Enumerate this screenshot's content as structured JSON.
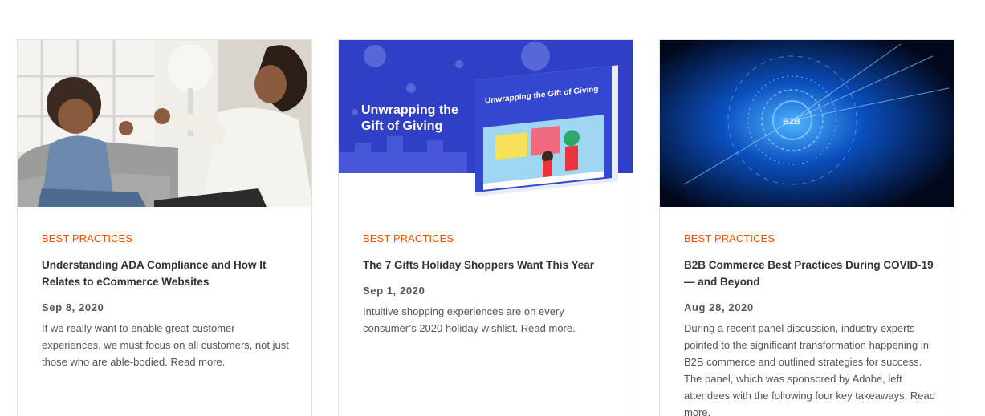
{
  "cards": [
    {
      "category": "BEST PRACTICES",
      "title": "Understanding ADA Compliance and How It Relates to eCommerce Websites",
      "date": "Sep 8, 2020",
      "excerpt": "If we really want to enable great customer experiences, we must focus on all customers, not just those who are able-bodied.",
      "read_more": "Read more.",
      "image": "woman-and-girl-photo"
    },
    {
      "category": "BEST PRACTICES",
      "title": "The 7 Gifts Holiday Shoppers Want This Year",
      "date": "Sep 1, 2020",
      "excerpt": "Intuitive shopping experiences are on every consumer’s 2020 holiday wishlist.",
      "read_more": "Read more.",
      "image": "gift-of-giving-ebook",
      "banner_text": "Unwrapping the Gift of Giving",
      "book_title": "Unwrapping the Gift of Giving"
    },
    {
      "category": "BEST PRACTICES",
      "title": "B2B Commerce Best Practices During COVID-19 — and Beyond",
      "date": "Aug 28, 2020",
      "excerpt": "During a recent panel discussion, industry experts pointed to the significant transformation happening in B2B commerce and outlined strategies for success. The panel, which was sponsored by Adobe, left attendees with the following four key takeaways.",
      "read_more": "Read more.",
      "image": "b2b-digital-circle",
      "b2b_label": "B2B"
    }
  ],
  "colors": {
    "category": "#eb5202",
    "text": "#333333",
    "border": "#e1e1e1"
  }
}
